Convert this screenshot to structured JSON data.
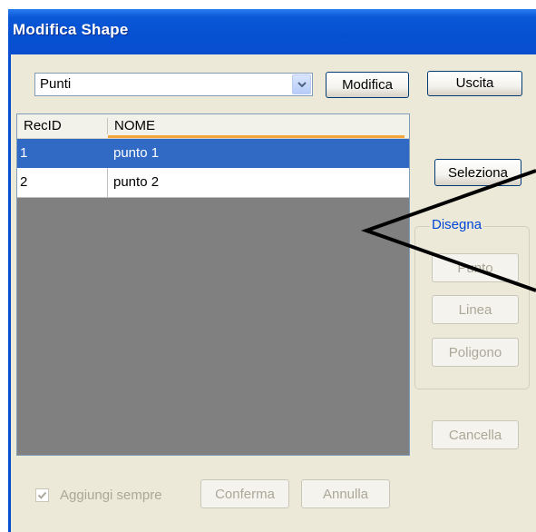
{
  "window": {
    "title": "Modifica Shape"
  },
  "layer_select": {
    "value": "Punti"
  },
  "buttons": {
    "modifica": "Modifica",
    "uscita": "Uscita",
    "seleziona": "Seleziona",
    "cancella": "Cancella",
    "conferma": "Conferma",
    "annulla": "Annulla"
  },
  "grid": {
    "columns": [
      "RecID",
      "NOME"
    ],
    "rows": [
      {
        "recid": "1",
        "nome": "punto 1",
        "selected": true
      },
      {
        "recid": "2",
        "nome": "punto 2",
        "selected": false
      }
    ]
  },
  "draw_group": {
    "legend": "Disegna",
    "buttons": [
      "Punto",
      "Linea",
      "Poligono"
    ]
  },
  "checkbox": {
    "label": "Aggiungi sempre",
    "checked": true,
    "enabled": false
  },
  "colors": {
    "title_bar": "#0a4ed0",
    "selection": "#316ac5",
    "sort_indicator": "#f4a63a",
    "legend": "#0046d5"
  }
}
